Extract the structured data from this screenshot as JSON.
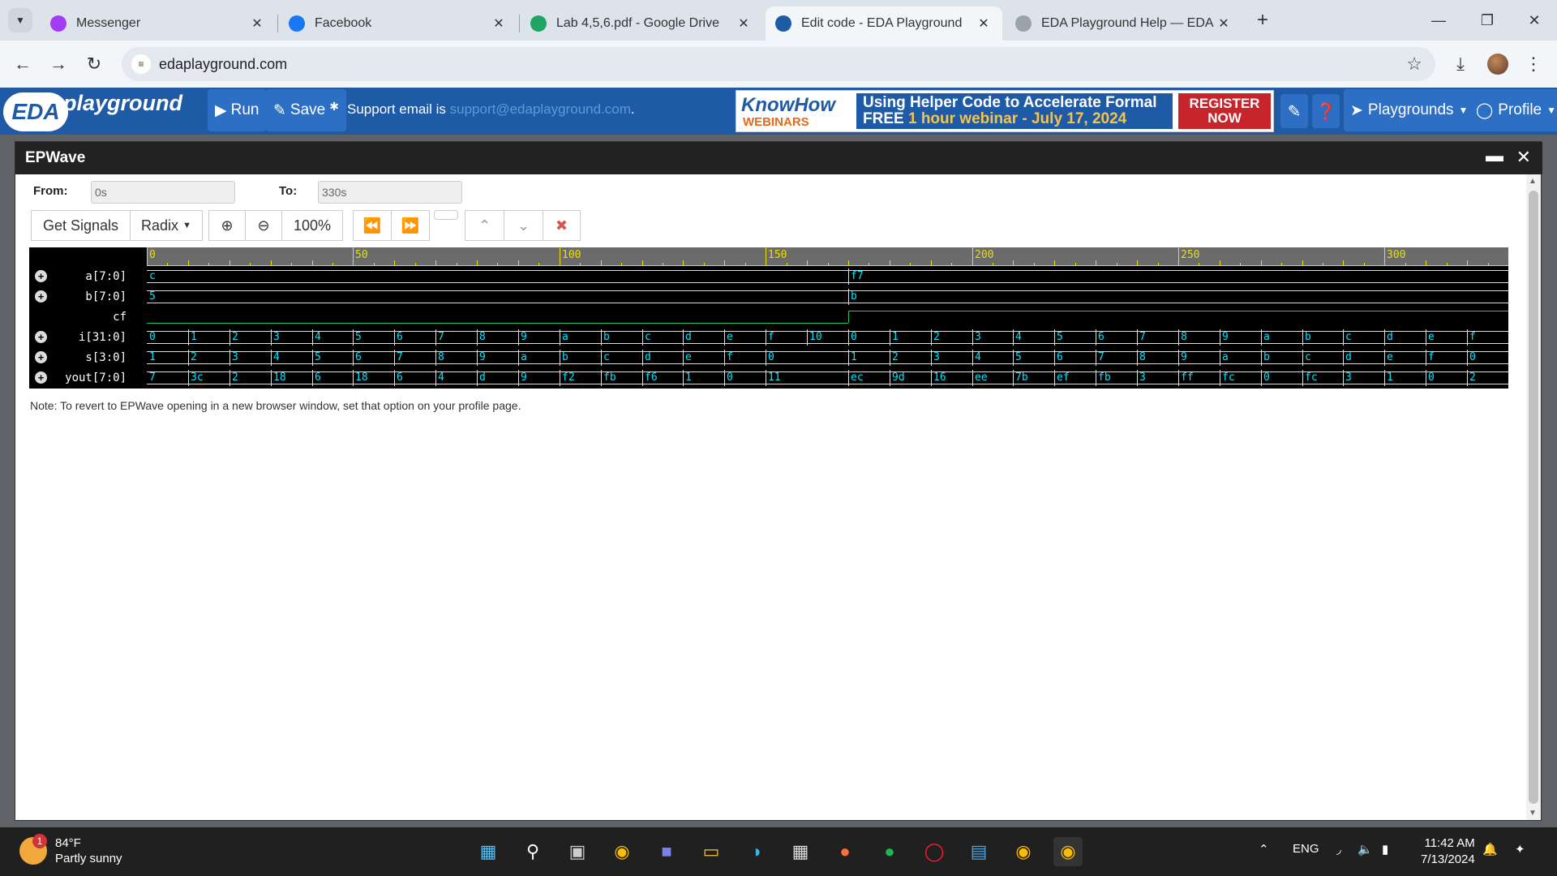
{
  "browser": {
    "tabs": [
      {
        "title": "Messenger",
        "icon": "messenger-icon",
        "color": "#a33bf5",
        "active": false
      },
      {
        "title": "Facebook",
        "icon": "facebook-icon",
        "color": "#1877f2",
        "active": false
      },
      {
        "title": "Lab 4,5,6.pdf - Google Drive",
        "icon": "google-drive-icon",
        "color": "#1fa463",
        "active": false
      },
      {
        "title": "Edit code - EDA Playground",
        "icon": "eda-icon",
        "color": "#1f5aa6",
        "active": true
      },
      {
        "title": "EDA Playground Help — EDA P",
        "icon": "eda-help-icon",
        "color": "#9aa3ad",
        "active": false
      }
    ],
    "url": "edaplayground.com"
  },
  "eda": {
    "logo": "EDA",
    "logo_word": "playground",
    "run": "Run",
    "save": "Save",
    "support_prefix": "Support email is ",
    "support_email": "support@edaplayground.com",
    "support_suffix": ".",
    "banner": {
      "know": "KnowHow",
      "webinars": "WEBINARS",
      "line1": "Using Helper Code to Accelerate Formal",
      "free": "FREE",
      "line2": "1 hour webinar - July 17, 2024",
      "register": "REGISTER NOW"
    },
    "playgrounds": "Playgrounds",
    "profile": "Profile"
  },
  "epwave": {
    "title": "EPWave",
    "from_label": "From:",
    "from_value": "0s",
    "to_label": "To:",
    "to_value": "330s",
    "get_signals": "Get Signals",
    "radix": "Radix",
    "zoom": "100%",
    "note": "Note: To revert to EPWave opening in a new browser window, set that option on your profile page.",
    "ruler_labels": [
      "0",
      "50",
      "100",
      "150",
      "200",
      "250",
      "300"
    ],
    "time_end": 330,
    "signals": [
      {
        "name": "a[7:0]",
        "expand": true,
        "type": "bus",
        "changes": [
          [
            0,
            "c"
          ],
          [
            170,
            "f7"
          ]
        ]
      },
      {
        "name": "b[7:0]",
        "expand": true,
        "type": "bus",
        "changes": [
          [
            0,
            "5"
          ],
          [
            170,
            "b"
          ]
        ]
      },
      {
        "name": "cf",
        "expand": false,
        "type": "bit",
        "levels": [
          [
            0,
            0
          ],
          [
            170,
            1
          ]
        ]
      },
      {
        "name": "i[31:0]",
        "expand": true,
        "type": "bus",
        "changes": [
          [
            0,
            "0"
          ],
          [
            10,
            "1"
          ],
          [
            20,
            "2"
          ],
          [
            30,
            "3"
          ],
          [
            40,
            "4"
          ],
          [
            50,
            "5"
          ],
          [
            60,
            "6"
          ],
          [
            70,
            "7"
          ],
          [
            80,
            "8"
          ],
          [
            90,
            "9"
          ],
          [
            100,
            "a"
          ],
          [
            110,
            "b"
          ],
          [
            120,
            "c"
          ],
          [
            130,
            "d"
          ],
          [
            140,
            "e"
          ],
          [
            150,
            "f"
          ],
          [
            160,
            "10"
          ],
          [
            170,
            "0"
          ],
          [
            180,
            "1"
          ],
          [
            190,
            "2"
          ],
          [
            200,
            "3"
          ],
          [
            210,
            "4"
          ],
          [
            220,
            "5"
          ],
          [
            230,
            "6"
          ],
          [
            240,
            "7"
          ],
          [
            250,
            "8"
          ],
          [
            260,
            "9"
          ],
          [
            270,
            "a"
          ],
          [
            280,
            "b"
          ],
          [
            290,
            "c"
          ],
          [
            300,
            "d"
          ],
          [
            310,
            "e"
          ],
          [
            320,
            "f"
          ]
        ]
      },
      {
        "name": "s[3:0]",
        "expand": true,
        "type": "bus",
        "changes": [
          [
            0,
            "1"
          ],
          [
            10,
            "2"
          ],
          [
            20,
            "3"
          ],
          [
            30,
            "4"
          ],
          [
            40,
            "5"
          ],
          [
            50,
            "6"
          ],
          [
            60,
            "7"
          ],
          [
            70,
            "8"
          ],
          [
            80,
            "9"
          ],
          [
            90,
            "a"
          ],
          [
            100,
            "b"
          ],
          [
            110,
            "c"
          ],
          [
            120,
            "d"
          ],
          [
            130,
            "e"
          ],
          [
            140,
            "f"
          ],
          [
            150,
            "0"
          ],
          [
            170,
            "1"
          ],
          [
            180,
            "2"
          ],
          [
            190,
            "3"
          ],
          [
            200,
            "4"
          ],
          [
            210,
            "5"
          ],
          [
            220,
            "6"
          ],
          [
            230,
            "7"
          ],
          [
            240,
            "8"
          ],
          [
            250,
            "9"
          ],
          [
            260,
            "a"
          ],
          [
            270,
            "b"
          ],
          [
            280,
            "c"
          ],
          [
            290,
            "d"
          ],
          [
            300,
            "e"
          ],
          [
            310,
            "f"
          ],
          [
            320,
            "0"
          ]
        ]
      },
      {
        "name": "yout[7:0]",
        "expand": true,
        "type": "bus",
        "changes": [
          [
            0,
            "7"
          ],
          [
            10,
            "3c"
          ],
          [
            20,
            "2"
          ],
          [
            30,
            "18"
          ],
          [
            40,
            "6"
          ],
          [
            50,
            "18"
          ],
          [
            60,
            "6"
          ],
          [
            70,
            "4"
          ],
          [
            80,
            "d"
          ],
          [
            90,
            "9"
          ],
          [
            100,
            "f2"
          ],
          [
            110,
            "fb"
          ],
          [
            120,
            "f6"
          ],
          [
            130,
            "1"
          ],
          [
            140,
            "0"
          ],
          [
            150,
            "11"
          ],
          [
            170,
            "ec"
          ],
          [
            180,
            "9d"
          ],
          [
            190,
            "16"
          ],
          [
            200,
            "ee"
          ],
          [
            210,
            "7b"
          ],
          [
            220,
            "ef"
          ],
          [
            230,
            "fb"
          ],
          [
            240,
            "3"
          ],
          [
            250,
            "ff"
          ],
          [
            260,
            "fc"
          ],
          [
            270,
            "0"
          ],
          [
            280,
            "fc"
          ],
          [
            290,
            "3"
          ],
          [
            300,
            "1"
          ],
          [
            310,
            "0"
          ],
          [
            320,
            "2"
          ]
        ]
      }
    ]
  },
  "taskbar": {
    "temp": "84°F",
    "condition": "Partly sunny",
    "badge": "1",
    "lang": "ENG",
    "time": "11:42 AM",
    "date": "7/13/2024"
  }
}
